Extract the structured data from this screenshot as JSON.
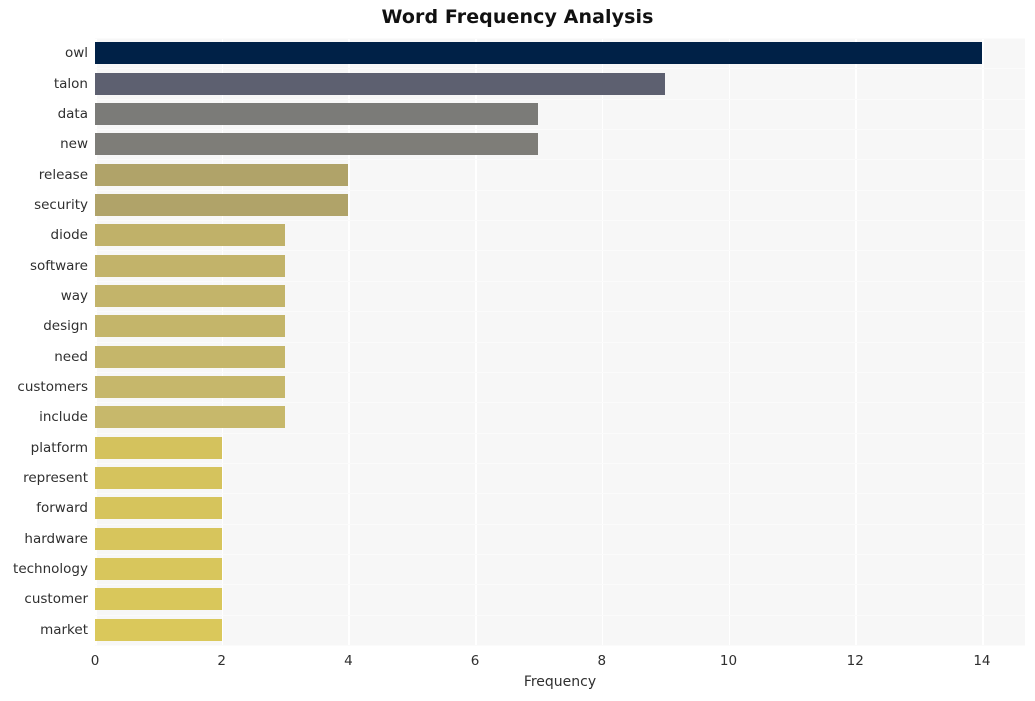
{
  "chart_data": {
    "type": "bar",
    "orientation": "horizontal",
    "title": "Word Frequency Analysis",
    "xlabel": "Frequency",
    "ylabel": "",
    "xlim": [
      0,
      14.68
    ],
    "xticks": [
      0,
      2,
      4,
      6,
      8,
      10,
      12,
      14
    ],
    "xtick_labels": [
      "0",
      "2",
      "4",
      "6",
      "8",
      "10",
      "12",
      "14"
    ],
    "grid": true,
    "grid_axis": "both",
    "legend": false,
    "categories": [
      "owl",
      "talon",
      "data",
      "new",
      "release",
      "security",
      "diode",
      "software",
      "way",
      "design",
      "need",
      "customers",
      "include",
      "platform",
      "represent",
      "forward",
      "hardware",
      "technology",
      "customer",
      "market"
    ],
    "values": [
      14,
      9,
      7,
      7,
      4,
      4,
      3,
      3,
      3,
      3,
      3,
      3,
      3,
      2,
      2,
      2,
      2,
      2,
      2,
      2
    ],
    "bar_colors": [
      "#002147",
      "#5d6070",
      "#7b7b78",
      "#7e7d78",
      "#b0a369",
      "#b0a369",
      "#c0b169",
      "#c2b36a",
      "#c3b46a",
      "#c4b56a",
      "#c5b66a",
      "#c6b76b",
      "#c7b86b",
      "#d4c25d",
      "#d5c35d",
      "#d6c45c",
      "#d7c55c",
      "#d8c65c",
      "#d9c75b",
      "#dac85b"
    ],
    "colors": {
      "plot_background": "#f7f7f7",
      "figure_background": "#ffffff",
      "gridline": "#ffffff",
      "title": "#111111",
      "tick_label": "#2f2f2f",
      "highest": "#002147",
      "lowest": "#dac85b"
    }
  }
}
